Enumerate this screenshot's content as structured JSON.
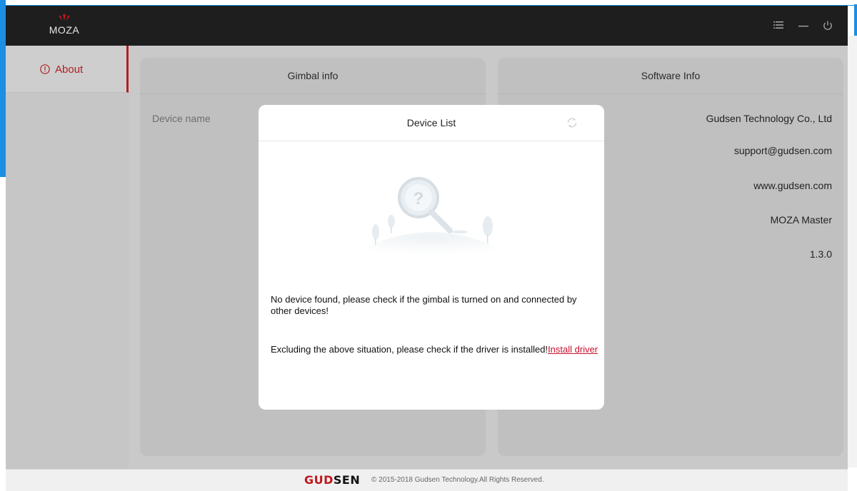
{
  "app": {
    "logo_text": "MOZA"
  },
  "titlebar": {
    "icons": [
      "menu-icon",
      "minimize-icon",
      "power-icon"
    ]
  },
  "sidebar": {
    "items": [
      {
        "label": "About",
        "icon": "info-circle-icon",
        "active": true
      }
    ]
  },
  "gimbal_info": {
    "title": "Gimbal info",
    "fields": [
      {
        "label": "Device name"
      }
    ]
  },
  "software_info": {
    "title": "Software Info",
    "rows": [
      "Gudsen Technology Co., Ltd",
      "support@gudsen.com",
      "www.gudsen.com",
      "MOZA Master",
      "1.3.0"
    ]
  },
  "modal": {
    "title": "Device List",
    "refresh_icon": "refresh-icon",
    "message": "No device found, please check if the gimbal is turned on and connected by other devices!",
    "driver_message": "Excluding the above situation, please check if the driver is installed!",
    "install_link": "Install driver"
  },
  "footer": {
    "brand_part1": "GUD",
    "brand_part2": "SEN",
    "copyright": "© 2015-2018 Gudsen Technology.All Rights Reserved."
  },
  "colors": {
    "accent": "#b11e24",
    "titlebar": "#1e1e1e",
    "link": "#c8102e"
  }
}
